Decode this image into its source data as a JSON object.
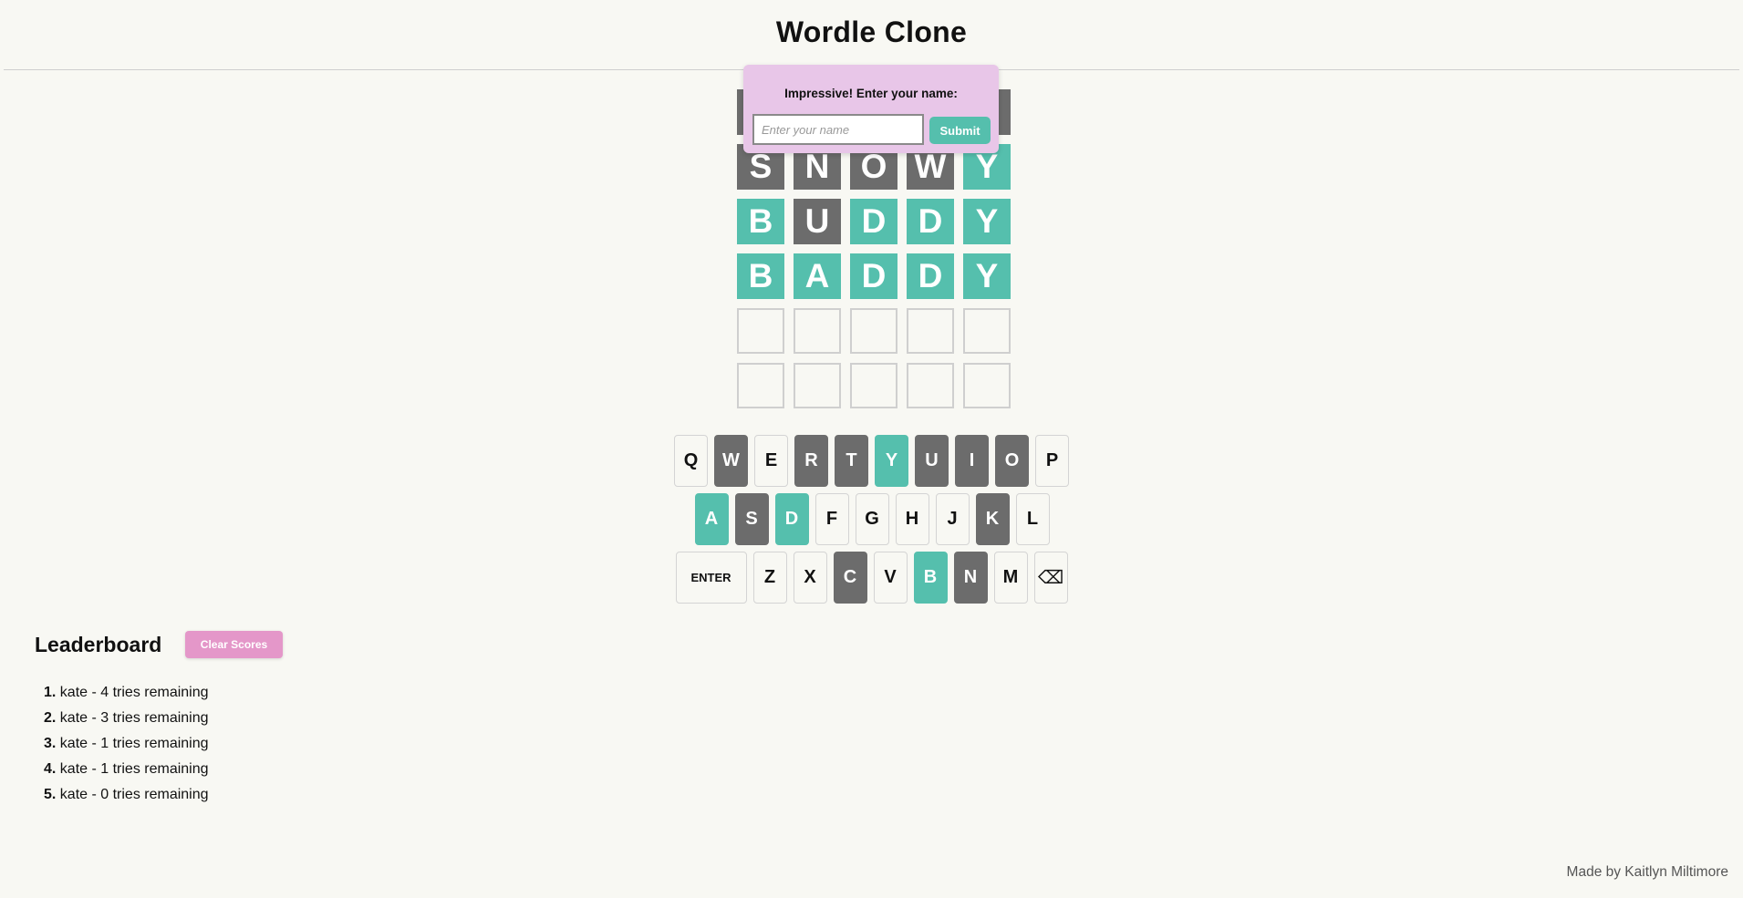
{
  "header": {
    "title": "Wordle Clone"
  },
  "board": {
    "rows": [
      [
        {
          "letter": "",
          "state": "absent"
        },
        {
          "letter": "",
          "state": "absent"
        },
        {
          "letter": "",
          "state": "absent"
        },
        {
          "letter": "",
          "state": "absent"
        },
        {
          "letter": "",
          "state": "absent"
        }
      ],
      [
        {
          "letter": "S",
          "state": "absent"
        },
        {
          "letter": "N",
          "state": "absent"
        },
        {
          "letter": "O",
          "state": "absent"
        },
        {
          "letter": "W",
          "state": "absent"
        },
        {
          "letter": "Y",
          "state": "correct"
        }
      ],
      [
        {
          "letter": "B",
          "state": "correct"
        },
        {
          "letter": "U",
          "state": "absent"
        },
        {
          "letter": "D",
          "state": "correct"
        },
        {
          "letter": "D",
          "state": "correct"
        },
        {
          "letter": "Y",
          "state": "correct"
        }
      ],
      [
        {
          "letter": "B",
          "state": "correct"
        },
        {
          "letter": "A",
          "state": "correct"
        },
        {
          "letter": "D",
          "state": "correct"
        },
        {
          "letter": "D",
          "state": "correct"
        },
        {
          "letter": "Y",
          "state": "correct"
        }
      ],
      [
        {
          "letter": "",
          "state": "empty"
        },
        {
          "letter": "",
          "state": "empty"
        },
        {
          "letter": "",
          "state": "empty"
        },
        {
          "letter": "",
          "state": "empty"
        },
        {
          "letter": "",
          "state": "empty"
        }
      ],
      [
        {
          "letter": "",
          "state": "empty"
        },
        {
          "letter": "",
          "state": "empty"
        },
        {
          "letter": "",
          "state": "empty"
        },
        {
          "letter": "",
          "state": "empty"
        },
        {
          "letter": "",
          "state": "empty"
        }
      ]
    ]
  },
  "popup": {
    "prompt": "Impressive! Enter your name:",
    "input_value": "",
    "input_placeholder": "Enter your name",
    "submit_label": "Submit"
  },
  "keyboard": {
    "rows": [
      [
        {
          "key": "Q",
          "state": "default"
        },
        {
          "key": "W",
          "state": "absent"
        },
        {
          "key": "E",
          "state": "default"
        },
        {
          "key": "R",
          "state": "absent"
        },
        {
          "key": "T",
          "state": "absent"
        },
        {
          "key": "Y",
          "state": "correct"
        },
        {
          "key": "U",
          "state": "absent"
        },
        {
          "key": "I",
          "state": "absent"
        },
        {
          "key": "O",
          "state": "absent"
        },
        {
          "key": "P",
          "state": "default"
        }
      ],
      [
        {
          "key": "A",
          "state": "correct"
        },
        {
          "key": "S",
          "state": "absent"
        },
        {
          "key": "D",
          "state": "correct"
        },
        {
          "key": "F",
          "state": "default"
        },
        {
          "key": "G",
          "state": "default"
        },
        {
          "key": "H",
          "state": "default"
        },
        {
          "key": "J",
          "state": "default"
        },
        {
          "key": "K",
          "state": "absent"
        },
        {
          "key": "L",
          "state": "default"
        }
      ],
      [
        {
          "key": "ENTER",
          "state": "default",
          "wide": true
        },
        {
          "key": "Z",
          "state": "default"
        },
        {
          "key": "X",
          "state": "default"
        },
        {
          "key": "C",
          "state": "absent"
        },
        {
          "key": "V",
          "state": "default"
        },
        {
          "key": "B",
          "state": "correct"
        },
        {
          "key": "N",
          "state": "absent"
        },
        {
          "key": "M",
          "state": "default"
        },
        {
          "key": "⌫",
          "state": "default",
          "icon": "backspace-icon"
        }
      ]
    ]
  },
  "leaderboard": {
    "title": "Leaderboard",
    "clear_label": "Clear Scores",
    "entries": [
      {
        "rank": "1.",
        "text": "kate - 4 tries remaining"
      },
      {
        "rank": "2.",
        "text": "kate - 3 tries remaining"
      },
      {
        "rank": "3.",
        "text": "kate - 1 tries remaining"
      },
      {
        "rank": "4.",
        "text": "kate - 1 tries remaining"
      },
      {
        "rank": "5.",
        "text": "kate - 0 tries remaining"
      }
    ]
  },
  "footer": {
    "credit": "Made by Kaitlyn Miltimore"
  },
  "colors": {
    "background": "#f8f8f3",
    "absent": "#6c6c6c",
    "correct": "#55bfad",
    "popup": "#e8c6e8",
    "clear_button": "#e497c9"
  }
}
